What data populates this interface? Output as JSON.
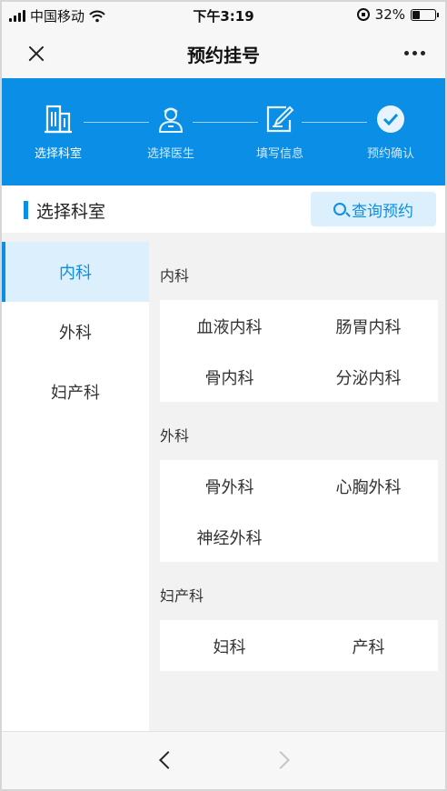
{
  "status_bar": {
    "carrier": "中国移动",
    "time": "下午3:19",
    "battery": "32%",
    "battery_level": 0.32
  },
  "nav": {
    "title": "预约挂号",
    "close_icon": "close-icon",
    "more_icon": "more-icon"
  },
  "steps": [
    {
      "label": "选择科室",
      "icon": "hospital-building-icon",
      "active": true
    },
    {
      "label": "选择医生",
      "icon": "doctor-icon",
      "active": false
    },
    {
      "label": "填写信息",
      "icon": "edit-form-icon",
      "active": false
    },
    {
      "label": "预约确认",
      "icon": "check-circle-icon",
      "active": false
    }
  ],
  "section": {
    "title": "选择科室",
    "query_button": "查询预约"
  },
  "sidebar": {
    "items": [
      "内科",
      "外科",
      "妇产科"
    ],
    "active_index": 0
  },
  "groups": [
    {
      "title": "内科",
      "departments": [
        "血液内科",
        "肠胃内科",
        "骨内科",
        "分泌内科"
      ]
    },
    {
      "title": "外科",
      "departments": [
        "骨外科",
        "心胸外科",
        "神经外科"
      ]
    },
    {
      "title": "妇产科",
      "departments": [
        "妇科",
        "产科"
      ]
    }
  ],
  "colors": {
    "accent": "#0b8fe6",
    "accent_light": "#dbeffc",
    "background": "#f2f2f2"
  }
}
